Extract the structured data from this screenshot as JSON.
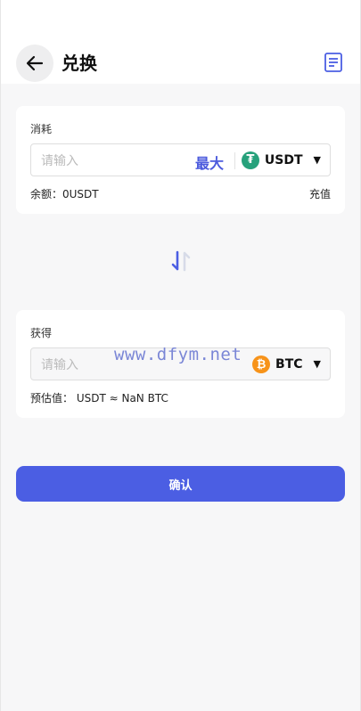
{
  "header": {
    "title": "兑换"
  },
  "pay": {
    "label": "消耗",
    "placeholder": "请输入",
    "max_label": "最大",
    "token": "USDT",
    "token_icon": "tether-icon",
    "balance": "余额：0USDT",
    "recharge_label": "充值"
  },
  "receive": {
    "label": "获得",
    "placeholder": "请输入",
    "token": "BTC",
    "token_icon": "bitcoin-icon",
    "estimate": "预估值： USDT ≈ NaN BTC",
    "watermark": "www.dfym.net"
  },
  "confirm_label": "确认",
  "colors": {
    "accent": "#4b5ee3",
    "usdt": "#26a17b",
    "btc": "#f7931a"
  }
}
